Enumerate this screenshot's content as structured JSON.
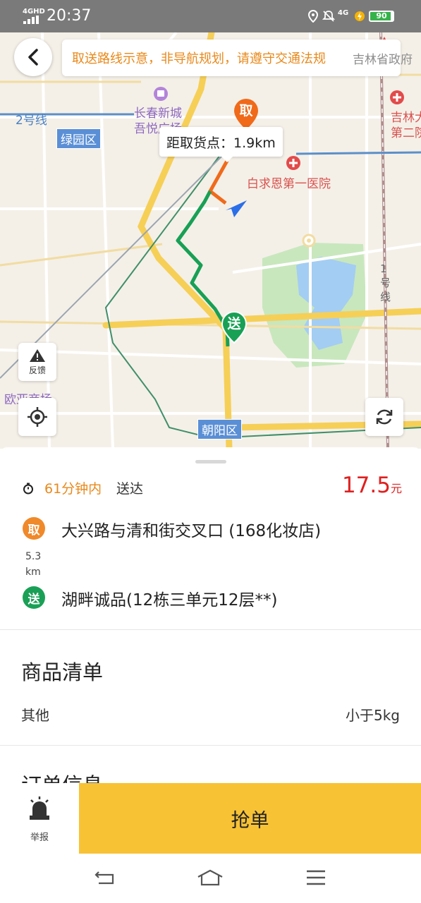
{
  "status_bar": {
    "network": "4GHD",
    "time": "20:37",
    "mobile_data": "4G",
    "battery": "90",
    "battery_level": 0.9
  },
  "map": {
    "notice": "取送路线示意，非导航规划，请遵守交通法规",
    "distance_tip": "距取货点：1.9km",
    "pickup_pin": "取",
    "delivery_pin": "送",
    "labels": {
      "mall_line1": "长春新城",
      "mall_line2": "吾悦广场",
      "hospital": "白求恩第一医院",
      "gov": "吉林省政府",
      "jilin_line1": "吉林大",
      "jilin_line2": "第二院",
      "line2": "2号线",
      "line1": "1号线",
      "ouya": "欧亚商场"
    },
    "districts": {
      "lvyuan": "绿园区",
      "chaoyang": "朝阳区"
    },
    "feedback_label": "反馈",
    "colors": {
      "pickup_route": "#f06a1a",
      "delivery_route": "#18a055",
      "water": "#a3cdf3",
      "park": "#c8e7bd",
      "major_road": "#f6cf57"
    }
  },
  "order": {
    "eta_value": "61分钟内",
    "eta_suffix": "送达",
    "price": "17.5",
    "price_unit": "元",
    "pickup_badge": "取",
    "pickup_address": "大兴路与清和街交叉口 (168化妆店)",
    "distance_value": "5.3",
    "distance_unit": "km",
    "delivery_badge": "送",
    "delivery_address": "湖畔诚品(12栋三单元12层**)",
    "goods_title": "商品清单",
    "goods_name": "其他",
    "goods_weight": "小于5kg",
    "order_info_title": "订单信息"
  },
  "bottom": {
    "report_label": "举报",
    "grab_label": "抢单"
  },
  "icons": {
    "back": "chevron-left-icon",
    "timer": "timer-icon",
    "feedback": "warning-icon",
    "locate": "crosshair-icon",
    "refresh": "refresh-icon",
    "report": "alarm-icon",
    "nav_back": "back-icon",
    "nav_home": "home-icon",
    "nav_menu": "menu-icon"
  }
}
